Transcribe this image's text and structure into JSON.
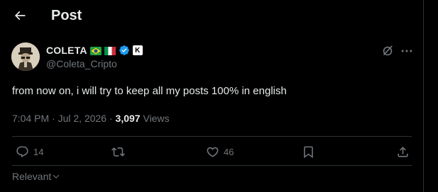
{
  "header": {
    "title": "Post"
  },
  "post": {
    "author": {
      "display_name": "COLETA",
      "handle": "@Coleta_Cripto",
      "badge_letter": "K"
    },
    "text": "from now on, i will try to keep all my posts 100% in english",
    "time": "7:04 PM",
    "date": "Jul 2, 2026",
    "views_count": "3,097",
    "views_label": "Views"
  },
  "actions": {
    "replies": "14",
    "reposts": "",
    "likes": "46"
  },
  "sort": {
    "label": "Relevant"
  },
  "colors": {
    "background": "#000000",
    "text": "#e7e9ea",
    "muted": "#71767b",
    "border": "#2f3336",
    "verified": "#1d9bf0"
  }
}
